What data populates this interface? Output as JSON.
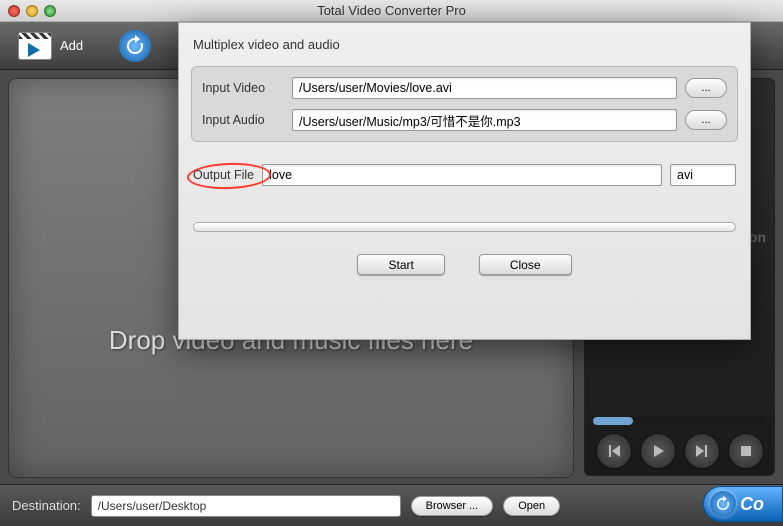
{
  "window": {
    "title": "Total Video Converter Pro"
  },
  "toolbar": {
    "add_label": "Add"
  },
  "dropzone": {
    "hint": "Drop video and music files here"
  },
  "preview": {
    "watermark_line1": "Total Video Con"
  },
  "bottombar": {
    "destination_label": "Destination:",
    "destination_value": "/Users/user/Desktop",
    "browser_label": "Browser ...",
    "open_label": "Open",
    "convert_label": "Co"
  },
  "dialog": {
    "title": "Multiplex video and audio",
    "input_video_label": "Input Video",
    "input_video_value": "/Users/user/Movies/love.avi",
    "input_audio_label": "Input Audio",
    "input_audio_value": "/Users/user/Music/mp3/可惜不是你.mp3",
    "browse_label": "...",
    "output_file_label": "Output File",
    "output_file_value": "love",
    "output_ext_value": "avi",
    "start_label": "Start",
    "close_label": "Close"
  }
}
